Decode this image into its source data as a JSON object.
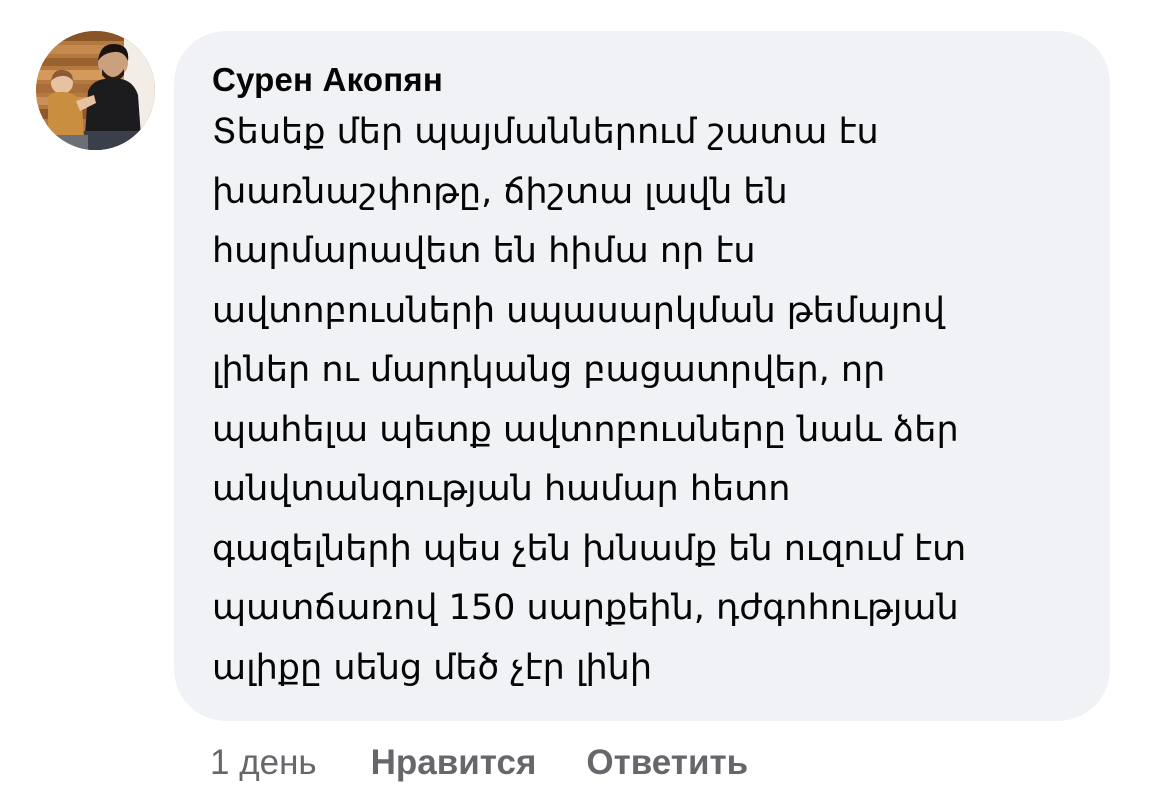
{
  "comment": {
    "author": "Сурен Акопян",
    "text": "Տեսեք մեր պայմաններում շատա էս\nխառնաշփոթը, ճիշտա լավն են\nհարմարավետ են հիմա որ էս\nավտոբուսների սպասարկման թեմայով\nլիներ ու մարդկանց բացատրվեր, որ\nպահելա պետք ավտոբուսները նաև ձեր\nանվտանգության համար հետո\nգազելների պես չեն խնամք են ուզում էտ\nպատճառով 150 սարքեին, դժգոհության\nալիքը սենց մեծ չէր լինի",
    "avatar_icon": "user-photo-icon"
  },
  "actions": {
    "time": "1 день",
    "like_label": "Нравится",
    "reply_label": "Ответить"
  },
  "colors": {
    "bubble_bg": "#f0f2f5",
    "text": "#050505",
    "secondary_text": "#65676b"
  }
}
